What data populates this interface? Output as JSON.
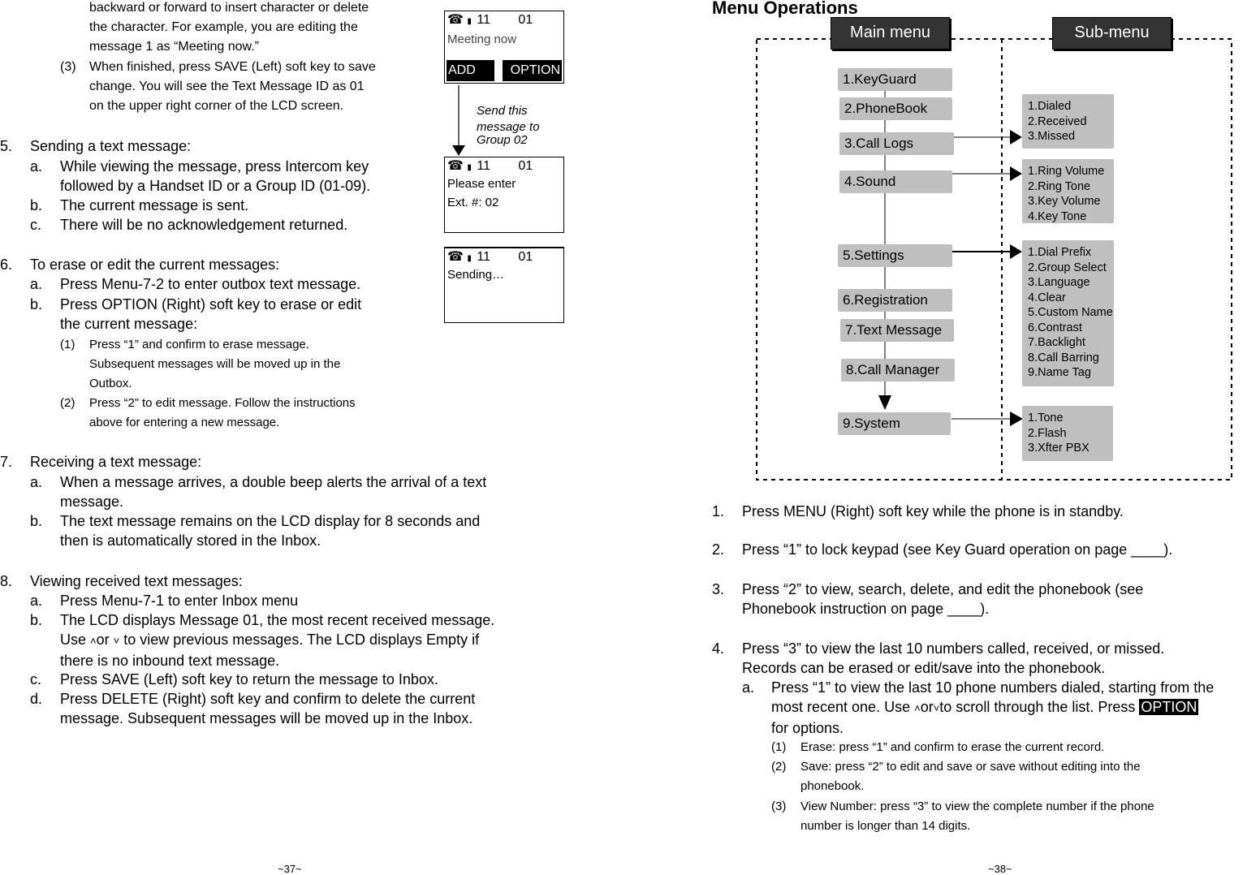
{
  "left_page": {
    "intro_lines": [
      "backward or forward to insert character or delete",
      "the character. For example, you are editing the",
      "message 1 as “Meeting now.”"
    ],
    "step3": {
      "num": "(3)",
      "lines": [
        "When finished, press SAVE (Left) soft key to save",
        "change. You will see the Text Message ID as 01",
        "on the upper right corner of the LCD screen."
      ]
    },
    "section5": {
      "num": "5.",
      "title": "Sending a text message:",
      "items": [
        {
          "label": "a.",
          "lines": [
            "While viewing the message, press Intercom key",
            "followed by a Handset ID or a Group ID (01-09)."
          ]
        },
        {
          "label": "b.",
          "lines": [
            "The current message is sent."
          ]
        },
        {
          "label": "c.",
          "lines": [
            "There will be no acknowledgement returned."
          ]
        }
      ]
    },
    "section6": {
      "num": "6.",
      "title": "To erase or edit the current messages:",
      "items": [
        {
          "label": "a.",
          "lines": [
            "Press Menu-7-2 to enter outbox text message."
          ]
        },
        {
          "label": "b.",
          "lines": [
            "Press OPTION (Right) soft key to erase or edit",
            "the current message:"
          ]
        }
      ],
      "subitems": [
        {
          "label": "(1)",
          "lines": [
            "Press “1” and confirm to erase message.",
            "Subsequent messages will be moved up in the",
            "Outbox."
          ]
        },
        {
          "label": "(2)",
          "lines": [
            "Press “2” to edit message.  Follow the instructions",
            "above for entering a new message."
          ]
        }
      ]
    },
    "section7": {
      "num": "7.",
      "title": "Receiving a text message:",
      "items": [
        {
          "label": "a.",
          "lines": [
            "When a message arrives, a double beep alerts the arrival of a text",
            "message."
          ]
        },
        {
          "label": "b.",
          "lines": [
            "The text message remains on the LCD display for 8 seconds and",
            "then is automatically stored in the Inbox."
          ]
        }
      ]
    },
    "section8": {
      "num": "8.",
      "title": "Viewing received text messages:",
      "items": [
        {
          "label": "a.",
          "lines": [
            "Press Menu-7-1 to enter Inbox menu"
          ]
        },
        {
          "label": "b.",
          "line1": "The LCD displays Message 01, the most recent received message.",
          "line2_pre": "Use ",
          "line2_or": "or ",
          "line2_post": " to view previous messages. The LCD displays Empty if",
          "line3": "there is no inbound text message."
        },
        {
          "label": "c.",
          "lines": [
            "Press SAVE (Left) soft key to return the message to Inbox."
          ]
        },
        {
          "label": "d.",
          "lines": [
            "Press DELETE (Right) soft key and confirm to delete the current",
            "message.  Subsequent messages will be moved up in the Inbox."
          ]
        }
      ]
    },
    "page_number": "~37~"
  },
  "lcd_screens": [
    {
      "icons": [
        "phone-icon",
        "battery-icon"
      ],
      "handset": "11",
      "msg_id": "01",
      "lines": [
        "Meeting now"
      ],
      "soft_left": "ADD",
      "soft_right": "OPTION"
    },
    {
      "icons": [
        "phone-icon",
        "battery-icon"
      ],
      "handset": "11",
      "msg_id": "01",
      "lines": [
        "Please enter",
        "Ext. #: 02"
      ]
    },
    {
      "icons": [
        "phone-icon",
        "battery-icon"
      ],
      "handset": "11",
      "msg_id": "01",
      "lines": [
        "Sending…"
      ]
    }
  ],
  "send_annotation": [
    "Send this",
    "message to",
    "Group 02"
  ],
  "right_page": {
    "title": "Menu Operations",
    "diagram": {
      "main_header": "Main menu",
      "sub_header": "Sub-menu",
      "main_items": [
        "1.KeyGuard",
        "2.PhoneBook",
        "3.Call Logs",
        "4.Sound",
        "5.Settings",
        "6.Registration",
        "7.Text Message",
        "8.Call Manager",
        "9.System"
      ],
      "submenus": [
        {
          "parent": "3.Call Logs",
          "items": [
            "1.Dialed",
            "2.Received",
            "3.Missed"
          ]
        },
        {
          "parent": "4.Sound",
          "items": [
            "1.Ring Volume",
            "2.Ring Tone",
            "3.Key Volume",
            "4.Key Tone"
          ]
        },
        {
          "parent": "5.Settings",
          "items": [
            "1.Dial Prefix",
            "2.Group Select",
            "3.Language",
            "4.Clear",
            "5.Custom Name",
            "6.Contrast",
            "7.Backlight",
            "8.Call Barring",
            "9.Name Tag"
          ]
        },
        {
          "parent": "9.System",
          "items": [
            "1.Tone",
            "2.Flash",
            "3.Xfter PBX"
          ]
        }
      ]
    },
    "steps": [
      {
        "num": "1.",
        "lines": [
          "Press MENU (Right) soft key while the phone is in standby."
        ]
      },
      {
        "num": "2.",
        "lines": [
          "Press “1” to lock keypad (see Key Guard operation on page ____)."
        ]
      },
      {
        "num": "3.",
        "lines": [
          "Press “2” to view, search, delete, and edit the phonebook (see",
          "Phonebook instruction on page ____)."
        ]
      },
      {
        "num": "4.",
        "lines": [
          "Press “3” to view the last 10 numbers called, received, or missed.",
          "Records can be erased or edit/save into the phonebook."
        ]
      }
    ],
    "step4a": {
      "label": "a.",
      "line1": "Press “1” to view the last 10 phone numbers dialed, starting from the",
      "line2_pre": "most recent one.  Use ",
      "line2_or": "or",
      "line2_post": "to scroll through the list. Press ",
      "option_chip": "OPTION",
      "line3": "for options."
    },
    "step4a_sub": [
      {
        "label": "(1)",
        "lines": [
          "Erase: press “1” and confirm to erase the current record."
        ]
      },
      {
        "label": "(2)",
        "lines": [
          "Save: press “2” to edit and save or save without editing into the",
          "phonebook."
        ]
      },
      {
        "label": "(3)",
        "lines": [
          "View Number: press “3” to view the complete number if the phone",
          "number is longer than 14 digits."
        ]
      }
    ],
    "page_number": "~38~"
  }
}
